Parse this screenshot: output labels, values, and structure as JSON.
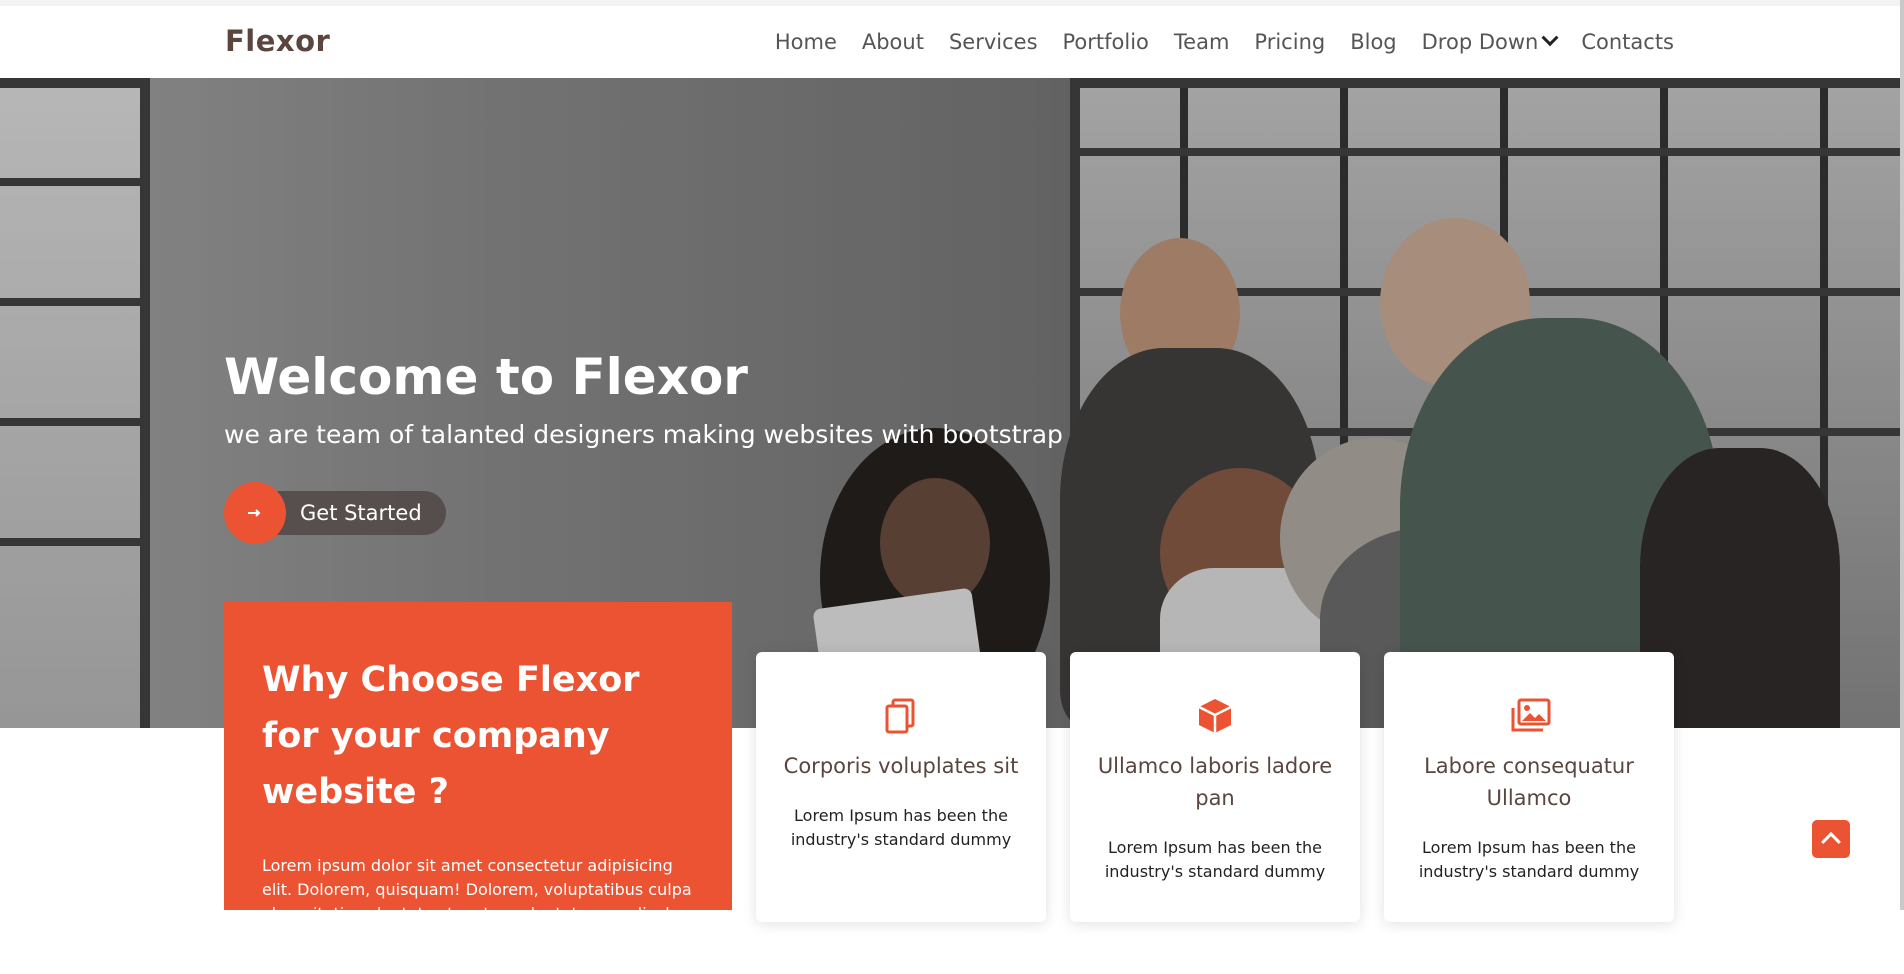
{
  "brand": {
    "name": "Flexor",
    "accent": "#eb5333"
  },
  "nav": {
    "items": [
      "Home",
      "About",
      "Services",
      "Portfolio",
      "Team",
      "Pricing",
      "Blog"
    ],
    "dropdown": "Drop Down",
    "contacts": "Contacts"
  },
  "hero": {
    "title": "Welcome to Flexor",
    "subtitle": "we are team of talanted designers making websites with bootstrap",
    "cta_label": "Get Started"
  },
  "why": {
    "title": "Why Choose Flexor for your company website ?",
    "text": "Lorem ipsum dolor sit amet consectetur adipisicing elit. Dolorem, quisquam! Dolorem, voluptatibus culpa ab veritatis voluptates tenetur voluptatum explicabo laboriosam quos dolore eveniet consequatur quia enim aspernatur inventore?"
  },
  "features": [
    {
      "icon": "document-copy-icon",
      "title": "Corporis voluplates sit",
      "text": "Lorem Ipsum has been the industry's standard dummy"
    },
    {
      "icon": "cube-icon",
      "title": "Ullamco laboris ladore pan",
      "text": "Lorem Ipsum has been the industry's standard dummy"
    },
    {
      "icon": "images-icon",
      "title": "Labore consequatur Ullamco",
      "text": "Lorem Ipsum has been the industry's standard dummy"
    }
  ],
  "icons": {
    "cta": "arrow-right-icon",
    "back_to_top": "arrow-up-icon",
    "dropdown": "chevron-down-icon"
  }
}
